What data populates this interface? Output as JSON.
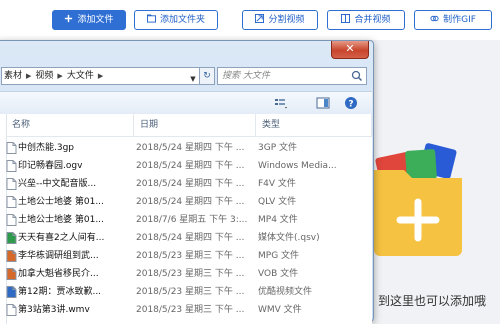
{
  "toolbar": {
    "add_file": "添加文件",
    "add_folder": "添加文件夹",
    "split_video": "分割视频",
    "merge_video": "合并视频",
    "make_gif": "制作GIF"
  },
  "dialog": {
    "close_symbol": "✕",
    "breadcrumb": [
      "素材",
      "视频",
      "大文件"
    ],
    "search_placeholder": "搜索 大文件",
    "columns": {
      "name": "名称",
      "date": "日期",
      "type": "类型"
    },
    "files": [
      {
        "name": "中创杰能.3gp",
        "date": "2018/5/24 星期四 下午 ...",
        "type": "3GP 文件",
        "icon": "video-file-icon"
      },
      {
        "name": "印记畅春园.ogv",
        "date": "2018/5/24 星期四 下午 ...",
        "type": "Windows Media...",
        "icon": "video-file-icon"
      },
      {
        "name": "兴垒--中文配音版...",
        "date": "2018/5/24 星期四 下午 ...",
        "type": "F4V 文件",
        "icon": "video-file-icon"
      },
      {
        "name": "土地公士地婆 第01...",
        "date": "2018/5/24 星期四 下午 ...",
        "type": "QLV 文件",
        "icon": "video-file-icon"
      },
      {
        "name": "土地公士地婆 第01...",
        "date": "2018/7/6 星期五 下午 3:...",
        "type": "MP4 文件",
        "icon": "video-file-icon"
      },
      {
        "name": "天天有喜2之人间有...",
        "date": "2018/5/24 星期四 下午 ...",
        "type": "媒体文件(.qsv)",
        "icon": "media-file-icon"
      },
      {
        "name": "李华栋调研组到武...",
        "date": "2018/5/23 星期三 下午 ...",
        "type": "MPG 文件",
        "icon": "mpg-file-icon"
      },
      {
        "name": "加拿大魁省移民介...",
        "date": "2018/5/23 星期三 下午 ...",
        "type": "VOB 文件",
        "icon": "vob-file-icon"
      },
      {
        "name": "第12期：贾冰致歉...",
        "date": "2018/5/23 星期三 下午 ...",
        "type": "优酷视频文件",
        "icon": "youku-file-icon"
      },
      {
        "name": "第3站第3讲.wmv",
        "date": "2018/5/23 星期三 下午 ...",
        "type": "WMV 文件",
        "icon": "wmv-file-icon"
      }
    ]
  },
  "drop_hint": "到这里也可以添加哦"
}
